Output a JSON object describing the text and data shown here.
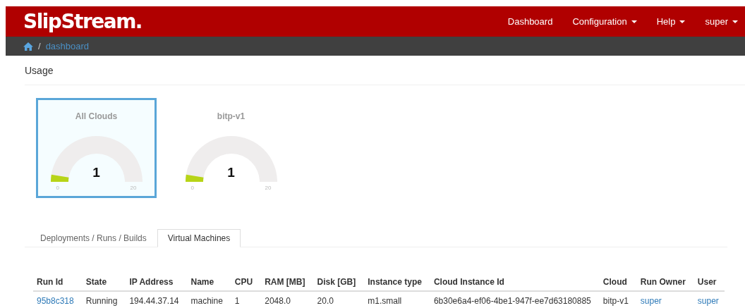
{
  "brand": "SlipStream.",
  "nav": [
    {
      "label": "Dashboard",
      "dropdown": false
    },
    {
      "label": "Configuration",
      "dropdown": true
    },
    {
      "label": "Help",
      "dropdown": true
    },
    {
      "label": "super",
      "dropdown": true
    }
  ],
  "breadcrumb": [
    {
      "separator": "/",
      "label": "dashboard"
    }
  ],
  "section_title": "Usage",
  "gauges": [
    {
      "title": "All Clouds",
      "value": "1",
      "min": "0",
      "max": "20",
      "selected": true
    },
    {
      "title": "bitp-v1",
      "value": "1",
      "min": "0",
      "max": "20",
      "selected": false
    }
  ],
  "tabs": [
    {
      "label": "Deployments / Runs / Builds",
      "selected": false
    },
    {
      "label": "Virtual Machines",
      "selected": true
    }
  ],
  "table": {
    "columns": [
      "Run Id",
      "State",
      "IP Address",
      "Name",
      "CPU",
      "RAM [MB]",
      "Disk [GB]",
      "Instance type",
      "Cloud Instance Id",
      "Cloud",
      "Run Owner",
      "User"
    ],
    "rows": [
      [
        {
          "text": "95b8c318",
          "kind": "link"
        },
        {
          "text": "Running",
          "kind": "text"
        },
        {
          "text": "194.44.37.14",
          "kind": "text"
        },
        {
          "text": "machine",
          "kind": "text"
        },
        {
          "text": "1",
          "kind": "text"
        },
        {
          "text": "2048.0",
          "kind": "text"
        },
        {
          "text": "20.0",
          "kind": "text"
        },
        {
          "text": "m1.small",
          "kind": "text"
        },
        {
          "text": "6b30e6a4-ef06-4be1-947f-ee7d63180885",
          "kind": "text"
        },
        {
          "text": "bitp-v1",
          "kind": "text"
        },
        {
          "text": "super",
          "kind": "link"
        },
        {
          "text": "super",
          "kind": "link"
        }
      ]
    ]
  }
}
